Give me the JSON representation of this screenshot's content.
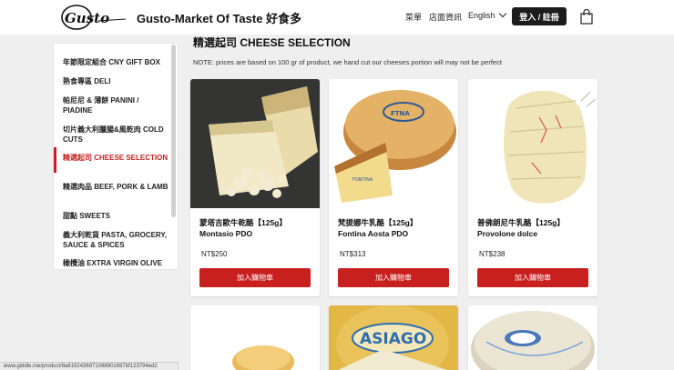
{
  "header": {
    "title": "Gusto-Market Of Taste 好食多",
    "nav": [
      "菜單",
      "店面資訊"
    ],
    "language": "English",
    "login_label": "登入 / 註冊"
  },
  "sidebar": {
    "items": [
      {
        "label": "年節限定組合 CNY GIFT BOX",
        "active": false
      },
      {
        "label": "熟食專區 DELI",
        "active": false
      },
      {
        "label": "帕尼尼 & 薄餅 PANINI / PIADINE",
        "active": false
      },
      {
        "label": "切片義大利臘腸&風乾肉 COLD CUTS",
        "active": false
      },
      {
        "label": "精選起司 CHEESE SELECTION",
        "active": true
      },
      {
        "label": "精選肉品 BEEF, PORK & LAMB",
        "active": false
      },
      {
        "label": "甜點 SWEETS",
        "active": false
      },
      {
        "label": "義大利乾貨 PASTA, GROCERY, SAUCE & SPICES",
        "active": false
      },
      {
        "label": "橄欖油 EXTRA VIRGIN OLIVE",
        "active": false
      }
    ]
  },
  "main": {
    "title": "精選起司 CHEESE SELECTION",
    "note": "NOTE: prices are based on 100 gr of product, we hand cut our cheeses portion will may not be perfect",
    "products": [
      {
        "name_zh": "蒙塔吉歐牛乾酪【125g】",
        "name_en": "Montasio PDO",
        "price": "NT$250",
        "button": "加入購物車"
      },
      {
        "name_zh": "梵提娜牛乳酪【125g】",
        "name_en": "Fontina Aosta PDO",
        "price": "NT$313",
        "button": "加入購物車"
      },
      {
        "name_zh": "普佛朗尼牛乳酪【125g】",
        "name_en": "Provolone dolce",
        "price": "NT$238",
        "button": "加入購物車"
      }
    ],
    "next_row_labels": [
      "ASIAGO"
    ]
  },
  "status_url": "www.giddle.me/product/8a8192436971088801697bf123794ed2",
  "colors": {
    "accent": "#c8201f",
    "dark": "#1c1c1c",
    "page_bg": "#efefef"
  }
}
